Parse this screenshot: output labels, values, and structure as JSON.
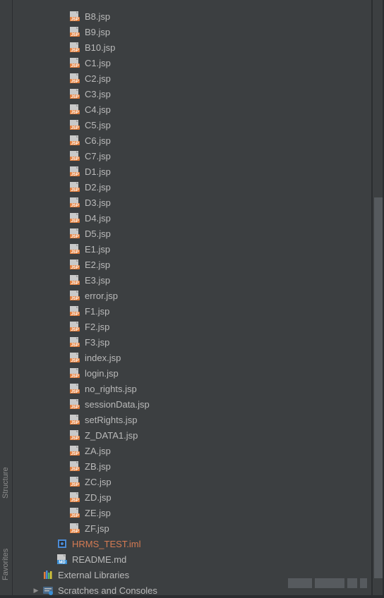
{
  "sidebar": {
    "structure_label": "Structure",
    "favorites_label": "Favorites"
  },
  "tree": {
    "files": [
      {
        "name": "B8.jsp",
        "type": "jsp",
        "depth": 4
      },
      {
        "name": "B9.jsp",
        "type": "jsp",
        "depth": 4
      },
      {
        "name": "B10.jsp",
        "type": "jsp",
        "depth": 4
      },
      {
        "name": "C1.jsp",
        "type": "jsp",
        "depth": 4
      },
      {
        "name": "C2.jsp",
        "type": "jsp",
        "depth": 4
      },
      {
        "name": "C3.jsp",
        "type": "jsp",
        "depth": 4
      },
      {
        "name": "C4.jsp",
        "type": "jsp",
        "depth": 4
      },
      {
        "name": "C5.jsp",
        "type": "jsp",
        "depth": 4
      },
      {
        "name": "C6.jsp",
        "type": "jsp",
        "depth": 4
      },
      {
        "name": "C7.jsp",
        "type": "jsp",
        "depth": 4
      },
      {
        "name": "D1.jsp",
        "type": "jsp",
        "depth": 4
      },
      {
        "name": "D2.jsp",
        "type": "jsp",
        "depth": 4
      },
      {
        "name": "D3.jsp",
        "type": "jsp",
        "depth": 4
      },
      {
        "name": "D4.jsp",
        "type": "jsp",
        "depth": 4
      },
      {
        "name": "D5.jsp",
        "type": "jsp",
        "depth": 4
      },
      {
        "name": "E1.jsp",
        "type": "jsp",
        "depth": 4
      },
      {
        "name": "E2.jsp",
        "type": "jsp",
        "depth": 4
      },
      {
        "name": "E3.jsp",
        "type": "jsp",
        "depth": 4
      },
      {
        "name": "error.jsp",
        "type": "jsp",
        "depth": 4
      },
      {
        "name": "F1.jsp",
        "type": "jsp",
        "depth": 4
      },
      {
        "name": "F2.jsp",
        "type": "jsp",
        "depth": 4
      },
      {
        "name": "F3.jsp",
        "type": "jsp",
        "depth": 4
      },
      {
        "name": "index.jsp",
        "type": "jsp",
        "depth": 4
      },
      {
        "name": "login.jsp",
        "type": "jsp",
        "depth": 4
      },
      {
        "name": "no_rights.jsp",
        "type": "jsp",
        "depth": 4
      },
      {
        "name": "sessionData.jsp",
        "type": "jsp",
        "depth": 4
      },
      {
        "name": "setRights.jsp",
        "type": "jsp",
        "depth": 4
      },
      {
        "name": "Z_DATA1.jsp",
        "type": "jsp",
        "depth": 4
      },
      {
        "name": "ZA.jsp",
        "type": "jsp",
        "depth": 4
      },
      {
        "name": "ZB.jsp",
        "type": "jsp",
        "depth": 4
      },
      {
        "name": "ZC.jsp",
        "type": "jsp",
        "depth": 4
      },
      {
        "name": "ZD.jsp",
        "type": "jsp",
        "depth": 4
      },
      {
        "name": "ZE.jsp",
        "type": "jsp",
        "depth": 4
      },
      {
        "name": "ZF.jsp",
        "type": "jsp",
        "depth": 4
      },
      {
        "name": "HRMS_TEST.iml",
        "type": "iml",
        "depth": 3,
        "highlighted": true
      },
      {
        "name": "README.md",
        "type": "md",
        "depth": 3
      },
      {
        "name": "External Libraries",
        "type": "lib",
        "depth": 1,
        "arrow": false
      },
      {
        "name": "Scratches and Consoles",
        "type": "scratch",
        "depth": 1,
        "arrow": true
      }
    ]
  }
}
